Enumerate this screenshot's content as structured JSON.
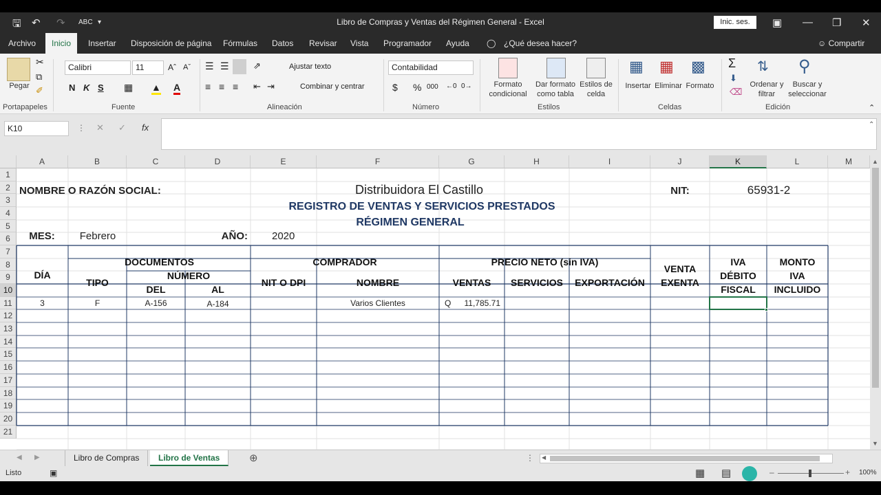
{
  "app": {
    "title": "Libro de Compras y Ventas del Régimen General  -  Excel",
    "signin": "Inic. ses."
  },
  "menu_tabs": [
    "Archivo",
    "Inicio",
    "Insertar",
    "Disposición de página",
    "Fórmulas",
    "Datos",
    "Revisar",
    "Vista",
    "Programador",
    "Ayuda"
  ],
  "tell_me": "¿Qué desea hacer?",
  "share": "Compartir",
  "ribbon": {
    "portapapeles": {
      "paste": "Pegar",
      "label": "Portapapeles"
    },
    "fuente": {
      "font": "Calibri",
      "size": "11",
      "bold": "N",
      "italic": "K",
      "underline": "S",
      "label": "Fuente"
    },
    "alineacion": {
      "wrap": "Ajustar texto",
      "merge": "Combinar y centrar",
      "label": "Alineación"
    },
    "numero": {
      "format": "Contabilidad",
      "label": "Número",
      "percent": "%",
      "thousands": "000"
    },
    "estilos": {
      "cond": "Formato condicional",
      "table": "Dar formato como tabla",
      "cell": "Estilos de celda",
      "label": "Estilos"
    },
    "celdas": {
      "insert": "Insertar",
      "delete": "Eliminar",
      "format": "Formato",
      "label": "Celdas"
    },
    "edicion": {
      "sort": "Ordenar y filtrar",
      "find": "Buscar y seleccionar",
      "label": "Edición"
    }
  },
  "formula": {
    "namebox": "K10",
    "fx": "fx",
    "value": ""
  },
  "columns": [
    "A",
    "B",
    "C",
    "D",
    "E",
    "F",
    "G",
    "H",
    "I",
    "J",
    "K",
    "L",
    "M"
  ],
  "rows": [
    "1",
    "2",
    "3",
    "4",
    "5",
    "6",
    "7",
    "8",
    "9",
    "10",
    "11",
    "12",
    "13",
    "14",
    "15",
    "16",
    "17",
    "18",
    "19",
    "20",
    "21"
  ],
  "sheet": {
    "nombre_label": "NOMBRE O RAZÓN SOCIAL:",
    "company": "Distribuidora El Castillo",
    "nit_label": "NIT:",
    "nit_value": "65931-2",
    "title1": "REGISTRO DE VENTAS Y SERVICIOS PRESTADOS",
    "title2": "RÉGIMEN GENERAL",
    "mes_label": "MES:",
    "mes_value": "Febrero",
    "anio_label": "AÑO:",
    "anio_value": "2020",
    "headers": {
      "dia": "DÍA",
      "documentos": "DOCUMENTOS",
      "tipo": "TIPO",
      "numero": "NÚMERO",
      "del": "DEL",
      "al": "AL",
      "comprador": "COMPRADOR",
      "nit_dpi": "NIT O DPI",
      "nombre": "NOMBRE",
      "precio_neto": "PRECIO NETO (sin IVA)",
      "ventas": "VENTAS",
      "servicios": "SERVICIOS",
      "exportacion": "EXPORTACIÓN",
      "venta_exenta_1": "VENTA",
      "venta_exenta_2": "EXENTA",
      "iva_1": "IVA",
      "iva_2": "DÉBITO",
      "iva_3": "FISCAL",
      "monto_1": "MONTO",
      "monto_2": "IVA",
      "monto_3": "INCLUIDO"
    },
    "row10": {
      "dia": "3",
      "tipo": "F",
      "del": "A-156",
      "al": "A-184",
      "nombre": "Varios Clientes",
      "currency": "Q",
      "ventas": "11,785.71"
    }
  },
  "sheet_tabs": [
    "Libro de Compras",
    "Libro de Ventas"
  ],
  "status": {
    "ready": "Listo",
    "zoom": "100%"
  }
}
